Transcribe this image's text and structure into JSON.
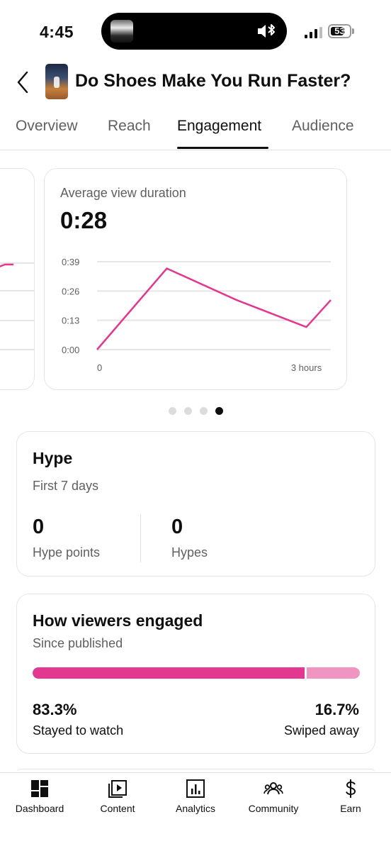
{
  "status_bar": {
    "time": "4:45",
    "battery": "53"
  },
  "header": {
    "title": "Do Shoes Make You Run Faster?"
  },
  "tabs": [
    {
      "label": "Overview"
    },
    {
      "label": "Reach"
    },
    {
      "label": "Engagement",
      "active": true
    },
    {
      "label": "Audience"
    }
  ],
  "avg_view_card": {
    "label": "Average view duration",
    "value": "0:28"
  },
  "chart_data": {
    "type": "line",
    "y_ticks": [
      "0:00",
      "0:13",
      "0:26",
      "0:39"
    ],
    "y_tick_seconds": [
      0,
      13,
      26,
      39
    ],
    "x_tick_labels": [
      "0",
      "3 hours"
    ],
    "ylim": [
      0,
      39
    ],
    "grid": true,
    "color": "#e2388f",
    "series": [
      {
        "x": [
          0,
          1,
          2,
          3,
          3.35
        ],
        "y": [
          0,
          36,
          22,
          10,
          22
        ]
      }
    ]
  },
  "carousel": {
    "count": 4,
    "active_index": 3
  },
  "hype": {
    "title": "Hype",
    "subtitle": "First 7 days",
    "points_value": "0",
    "points_label": "Hype points",
    "hypes_value": "0",
    "hypes_label": "Hypes"
  },
  "engagement": {
    "title": "How viewers engaged",
    "subtitle": "Since published",
    "stayed_pct": "83.3%",
    "stayed_label": "Stayed to watch",
    "swiped_pct": "16.7%",
    "swiped_label": "Swiped away",
    "stayed_fraction": 0.833,
    "swiped_fraction": 0.167,
    "stayed_color": "#e2388f",
    "swiped_color": "#f095c2"
  },
  "bottom_nav": [
    {
      "label": "Dashboard",
      "icon": "dashboard-icon"
    },
    {
      "label": "Content",
      "icon": "content-icon"
    },
    {
      "label": "Analytics",
      "icon": "analytics-icon"
    },
    {
      "label": "Community",
      "icon": "community-icon"
    },
    {
      "label": "Earn",
      "icon": "earn-icon"
    }
  ]
}
